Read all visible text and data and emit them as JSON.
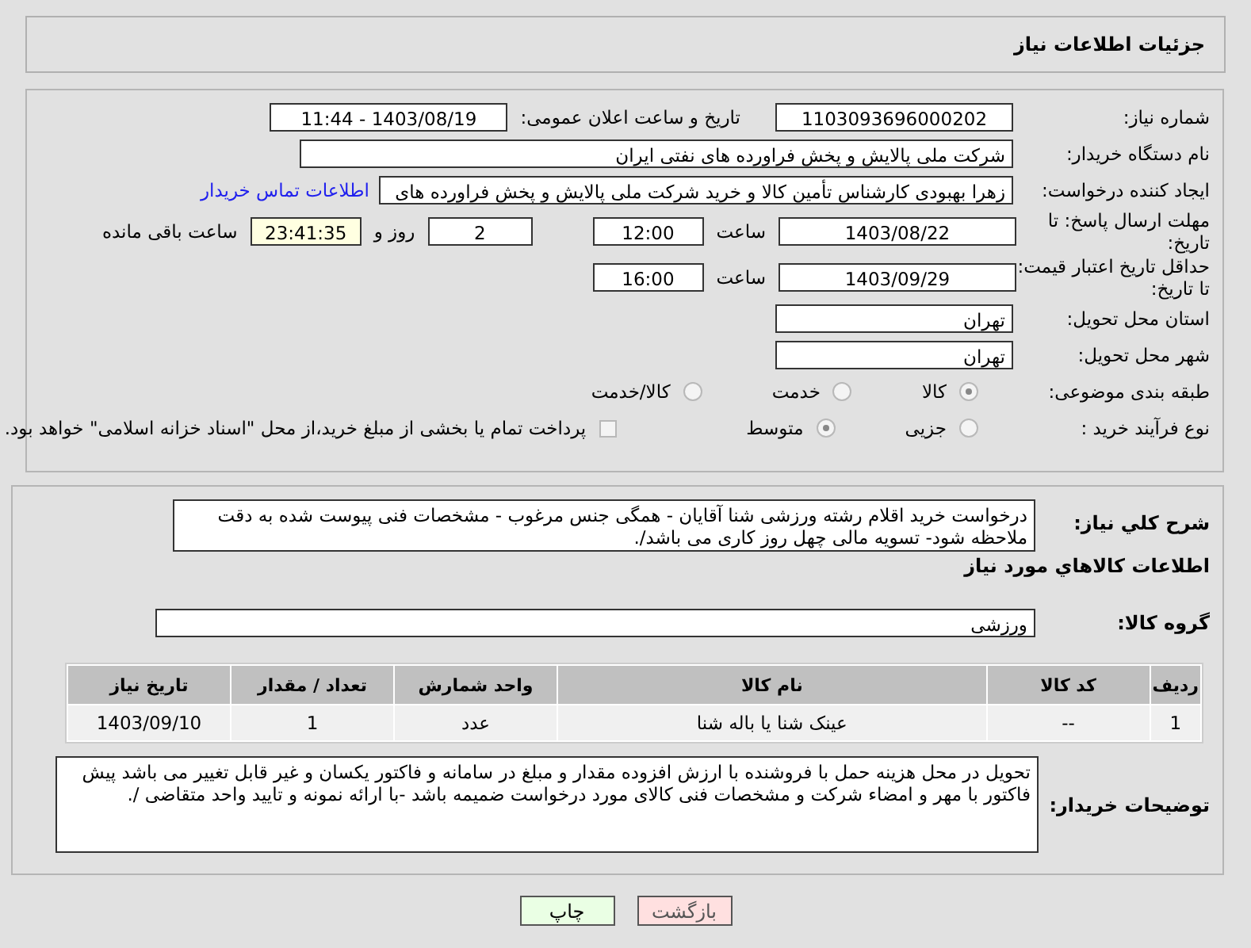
{
  "header": {
    "title": "جزئیات اطلاعات نیاز"
  },
  "need_number": {
    "label": "شماره نیاز:",
    "value": "1103093696000202"
  },
  "announce": {
    "label": "تاریخ و ساعت اعلان عمومی:",
    "value": "1403/08/19 - 11:44"
  },
  "buyer": {
    "label": "نام دستگاه خریدار:",
    "value": "شرکت ملی پالایش و پخش فراورده های نفتی ایران"
  },
  "requester": {
    "label": "ایجاد کننده درخواست:",
    "value": "زهرا بهبودی کارشناس تأمین کالا و خرید شرکت ملی پالایش و پخش فراورده های",
    "link": "اطلاعات تماس خریدار"
  },
  "deadline": {
    "label": "مهلت ارسال پاسخ: تا تاریخ:",
    "date": "1403/08/22",
    "time_label": "ساعت",
    "time": "12:00",
    "days": "2",
    "days_label": "روز و",
    "remaining": "23:41:35",
    "remaining_label": "ساعت باقی مانده"
  },
  "validity": {
    "label": "حداقل تاریخ اعتبار قیمت: تا تاریخ:",
    "date": "1403/09/29",
    "time_label": "ساعت",
    "time": "16:00"
  },
  "province": {
    "label": "استان محل تحویل:",
    "value": "تهران"
  },
  "city": {
    "label": "شهر محل تحویل:",
    "value": "تهران"
  },
  "category": {
    "label": "طبقه بندی موضوعی:",
    "options": [
      {
        "label": "کالا",
        "selected": true
      },
      {
        "label": "خدمت",
        "selected": false
      },
      {
        "label": "کالا/خدمت",
        "selected": false
      }
    ]
  },
  "process": {
    "label": "نوع فرآیند خرید :",
    "options": [
      {
        "label": "جزیی",
        "selected": false
      },
      {
        "label": "متوسط",
        "selected": true
      }
    ],
    "treasury": {
      "checked": false,
      "text": "پرداخت تمام یا بخشی از مبلغ خرید،از محل \"اسناد خزانه اسلامی\" خواهد بود."
    }
  },
  "description": {
    "label": "شرح كلي نياز:",
    "text": "درخواست خرید اقلام رشته ورزشی شنا آقایان - همگی جنس مرغوب - مشخصات فنی پیوست شده به دقت ملاحظه شود- تسویه مالی چهل روز کاری می باشد/."
  },
  "goods_heading": "اطلاعات كالاهاي مورد نياز",
  "goods_group": {
    "label": "گروه کالا:",
    "value": "ورزشی"
  },
  "table": {
    "columns": [
      "ردیف",
      "کد کالا",
      "نام کالا",
      "واحد شمارش",
      "تعداد / مقدار",
      "تاریخ نیاز"
    ],
    "rows": [
      [
        "1",
        "--",
        "عینک شنا یا باله شنا",
        "عدد",
        "1",
        "1403/09/10"
      ]
    ]
  },
  "buyer_notes": {
    "label": "توضیحات خریدار:",
    "text": "تحویل در محل هزینه  حمل با فروشنده با ارزش افزوده مقدار و مبلغ در سامانه و فاکتور یکسان و غیر قابل تغییر می باشد پیش فاکتور با مهر و امضاء شرکت و مشخصات فنی کالای مورد درخواست ضمیمه باشد -با ارائه نمونه و تایید واحد متقاضی /."
  },
  "buttons": [
    {
      "label": "بازگشت",
      "kind": "back"
    },
    {
      "label": "چاپ",
      "kind": "print"
    }
  ]
}
